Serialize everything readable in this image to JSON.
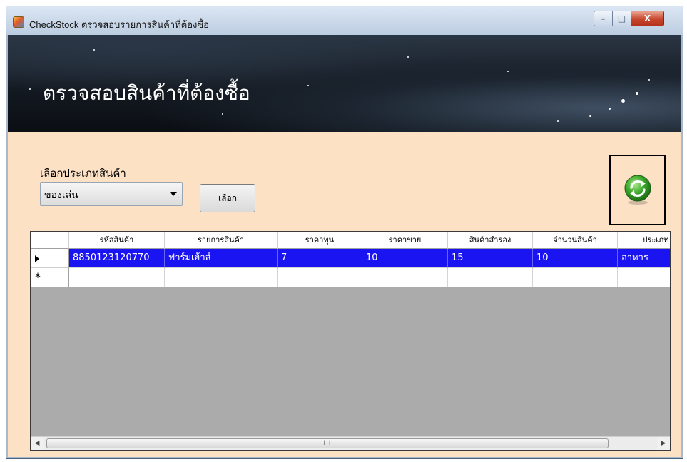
{
  "window": {
    "title": "CheckStock ตรวจสอบรายการสินค้าที่ต้องซื้อ",
    "controls": {
      "minimize": "–",
      "maximize": "□",
      "close": "X"
    }
  },
  "banner": {
    "title": "ตรวจสอบสินค้าที่ต้องซื้อ"
  },
  "filter": {
    "label": "เลือกประเภทสินค้า",
    "selected_category": "ของเล่น",
    "select_button": "เลือก"
  },
  "refresh": {
    "icon": "refresh-icon"
  },
  "grid": {
    "columns": [
      "รหัสสินค้า",
      "รายการสินค้า",
      "ราคาทุน",
      "ราคาขาย",
      "สินค้าสำรอง",
      "จำนวนสินค้า",
      "ประเภท"
    ],
    "rows": [
      {
        "indicator": "▶",
        "cells": [
          "8850123120770",
          "ฟาร์มเฮ้าส์",
          "7",
          "10",
          "15",
          "10",
          "อาหาร"
        ]
      }
    ],
    "new_row_indicator": "*",
    "scroll_grip": "III"
  },
  "colors": {
    "content_background": "#fde1c5",
    "selected_row": "#1a13f2",
    "close_button": "#c8452d"
  }
}
